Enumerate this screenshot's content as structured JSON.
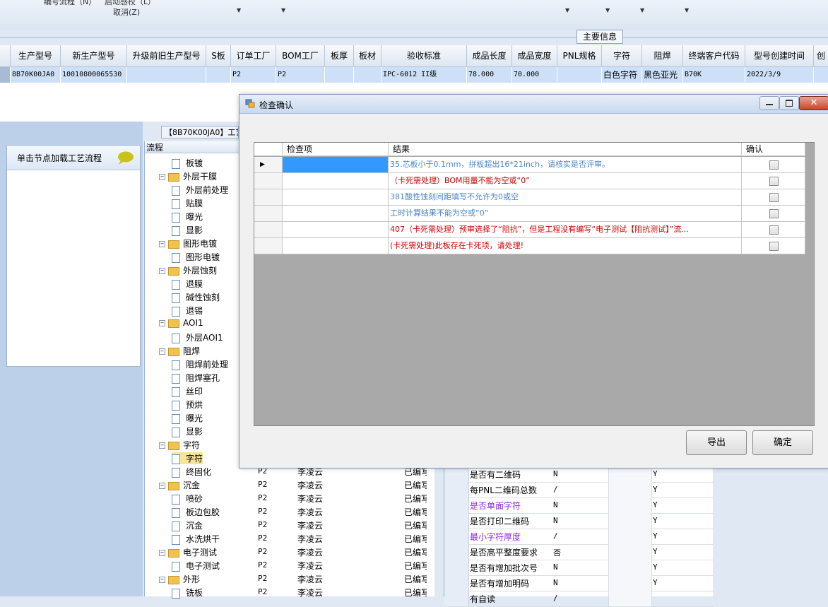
{
  "toolbar": {
    "partial_left": "编号流程（N）",
    "partial_mid": "启动感校（L）",
    "cancel_label": "取消(Z)"
  },
  "main_info_tab": "主要信息",
  "main_grid": {
    "columns": [
      "生产型号",
      "新生产型号",
      "升级前旧生产型号",
      "S板",
      "订单工厂",
      "BOM工厂",
      "板厚",
      "板材",
      "验收标准",
      "成品长度",
      "成品宽度",
      "PNL规格",
      "字符",
      "阻焊",
      "终端客户代码",
      "型号创建时间",
      "创"
    ],
    "row": [
      "8B70K00JA0",
      "10010800065530",
      "",
      "",
      "P2",
      "P2",
      "",
      "",
      "IPC-6012 II级",
      "78.000",
      "70.000",
      "",
      "白色字符",
      "黑色亚光",
      "B70K",
      "2022/3/9",
      ""
    ]
  },
  "left_panel": {
    "header_text": "单击节点加载工艺流程",
    "tab_label": "【8B70K00JA0】工艺"
  },
  "tree": {
    "header": "流程",
    "nodes": [
      {
        "label": "板镀",
        "type": "doc"
      },
      {
        "label": "外层干膜",
        "type": "folder"
      },
      {
        "label": "外层前处理",
        "type": "doc"
      },
      {
        "label": "贴膜",
        "type": "doc"
      },
      {
        "label": "曝光",
        "type": "doc"
      },
      {
        "label": "显影",
        "type": "doc"
      },
      {
        "label": "图形电镀",
        "type": "folder"
      },
      {
        "label": "图形电镀",
        "type": "doc"
      },
      {
        "label": "外层蚀刻",
        "type": "folder"
      },
      {
        "label": "退膜",
        "type": "doc"
      },
      {
        "label": "碱性蚀刻",
        "type": "doc"
      },
      {
        "label": "退锡",
        "type": "doc"
      },
      {
        "label": "AOI1",
        "type": "folder"
      },
      {
        "label": "外层AOI1",
        "type": "doc"
      },
      {
        "label": "阻焊",
        "type": "folder"
      },
      {
        "label": "阻焊前处理",
        "type": "doc"
      },
      {
        "label": "阻焊塞孔",
        "type": "doc"
      },
      {
        "label": "丝印",
        "type": "doc"
      },
      {
        "label": "预烘",
        "type": "doc"
      },
      {
        "label": "曝光",
        "type": "doc"
      },
      {
        "label": "显影",
        "type": "doc"
      },
      {
        "label": "字符",
        "type": "folder"
      },
      {
        "label": "字符",
        "type": "doc"
      },
      {
        "label": "终固化",
        "type": "doc"
      },
      {
        "label": "沉金",
        "type": "folder"
      },
      {
        "label": "喷砂",
        "type": "doc"
      },
      {
        "label": "板边包胶",
        "type": "doc"
      },
      {
        "label": "沉金",
        "type": "doc"
      },
      {
        "label": "水洗烘干",
        "type": "doc"
      },
      {
        "label": "电子测试",
        "type": "folder"
      },
      {
        "label": "电子测试",
        "type": "doc"
      },
      {
        "label": "外形",
        "type": "folder"
      },
      {
        "label": "铣板",
        "type": "doc"
      }
    ],
    "row_factory": "P2",
    "row_person": "李凌云",
    "row_status": "已编写"
  },
  "attr_grid": {
    "rows": [
      {
        "name": "是否有二维码",
        "value": "N",
        "flag": "Y",
        "highlight": false
      },
      {
        "name": "每PNL二维码总数",
        "value": "/",
        "flag": "Y",
        "highlight": false
      },
      {
        "name": "是否单面字符",
        "value": "N",
        "flag": "Y",
        "highlight": true
      },
      {
        "name": "是否打印二维码",
        "value": "N",
        "flag": "Y",
        "highlight": false
      },
      {
        "name": "最小字符厚度",
        "value": "/",
        "flag": "Y",
        "highlight": true
      },
      {
        "name": "是否高平整度要求",
        "value": "否",
        "flag": "Y",
        "highlight": false
      },
      {
        "name": "是否有增加批次号",
        "value": "N",
        "flag": "Y",
        "highlight": false
      },
      {
        "name": "是否有增加明码",
        "value": "N",
        "flag": "Y",
        "highlight": false
      },
      {
        "name": "有自读",
        "value": "/",
        "flag": "",
        "highlight": false
      }
    ]
  },
  "dialog": {
    "title": "检查确认",
    "columns": [
      "检查项",
      "结果",
      "确认"
    ],
    "rows": [
      {
        "item": "",
        "result": "35.芯板小于0.1mm，拼板超出16*21inch，请核实是否评审。",
        "color": "#4a86c8",
        "checked": false
      },
      {
        "item": "",
        "result": "（卡死需处理）BOM用量不能为空或“0”",
        "color": "#cc0000",
        "checked": false
      },
      {
        "item": "",
        "result": "381酸性蚀刻间距填写不允许为0或空",
        "color": "#4a86c8",
        "checked": false
      },
      {
        "item": "",
        "result": "工时计算结果不能为空或“0”",
        "color": "#4a86c8",
        "checked": false
      },
      {
        "item": "",
        "result": "407（卡死需处理）预审选择了“阻抗”，但是工程没有编写“电子测试【阻抗测试】”流...",
        "color": "#cc0000",
        "checked": false
      },
      {
        "item": "",
        "result": "(卡死需处理)此板存在卡死项，请处理!",
        "color": "#cc0000",
        "checked": false
      }
    ],
    "export_label": "导出",
    "ok_label": "确定"
  },
  "colors": {
    "selection": "#cde0f7",
    "info_blue": "#4a86c8",
    "error_red": "#cc0000",
    "highlight_purple": "#8a2be2"
  }
}
